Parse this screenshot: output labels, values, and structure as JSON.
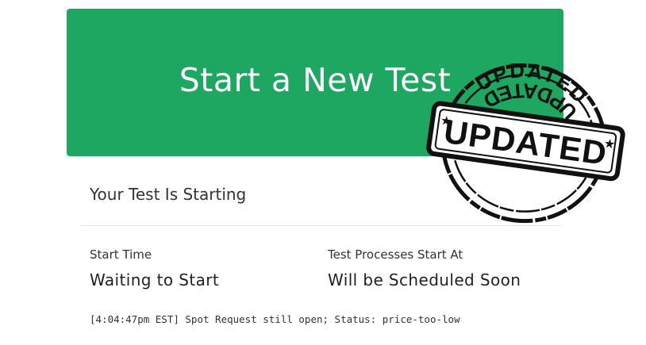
{
  "banner": {
    "title": "Start a New Test",
    "color": "#1ea761"
  },
  "status": {
    "heading": "Your Test Is Starting"
  },
  "fields": {
    "start_time_label": "Start Time",
    "start_time_value": "Waiting to Start",
    "processes_label": "Test Processes Start At",
    "processes_value": "Will be Scheduled Soon"
  },
  "log": {
    "line": "[4:04:47pm EST] Spot Request still open; Status: price-too-low"
  },
  "stamp": {
    "text": "UPDATED",
    "arc_top": "UPDATED",
    "arc_bottom": "UPDATED",
    "color": "#111111"
  }
}
